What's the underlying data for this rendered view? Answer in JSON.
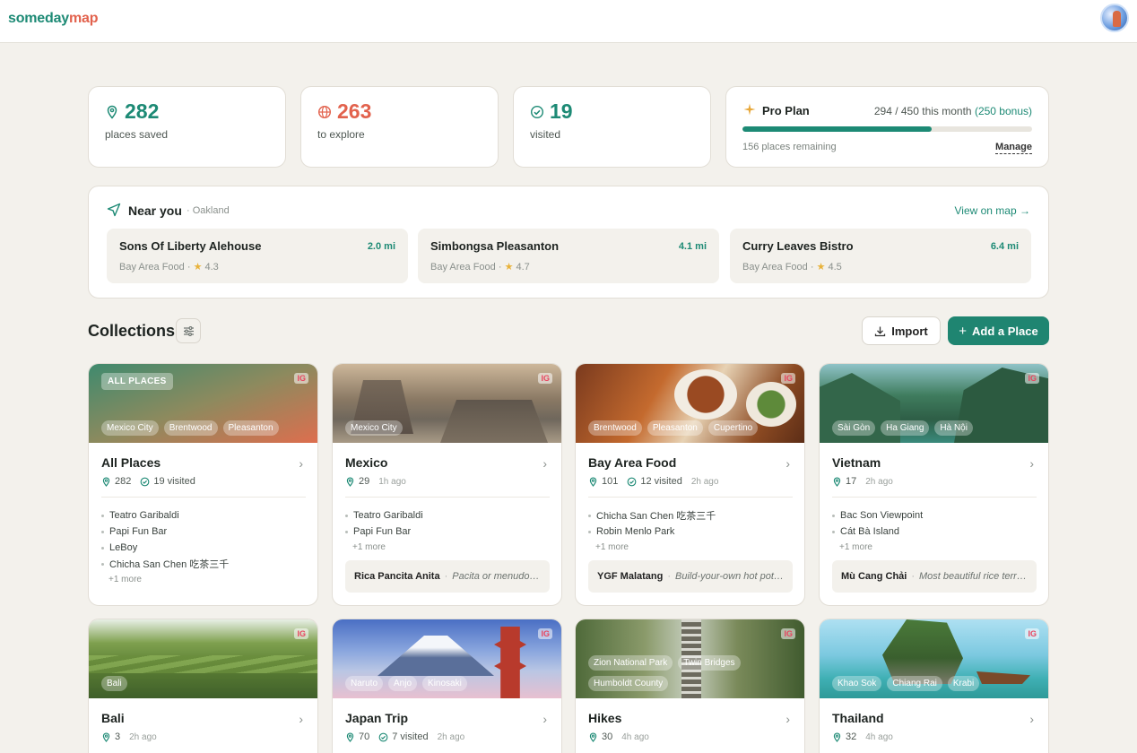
{
  "header": {
    "logo_part1": "someday",
    "logo_part2": "map",
    "colors": {
      "brand_green": "#1d8a75",
      "brand_coral": "#e2624d"
    }
  },
  "stats": [
    {
      "value": "282",
      "label": "places saved",
      "icon": "map-pin-icon",
      "color": "#1d8a75"
    },
    {
      "value": "263",
      "label": "to explore",
      "icon": "globe-icon",
      "color": "#e2624d"
    },
    {
      "value": "19",
      "label": "visited",
      "icon": "check-circle-icon",
      "color": "#1d8a75"
    }
  ],
  "plan": {
    "title": "Pro Plan",
    "usage": "294 / 450 this month",
    "bonus": "(250 bonus)",
    "used_fraction": 0.653,
    "remaining": "156 places remaining",
    "manage": "Manage"
  },
  "near": {
    "title": "Near you",
    "city": "· Oakland",
    "view_link": "View on map →",
    "items": [
      {
        "name": "Sons Of Liberty Alehouse",
        "distance": "2.0 mi",
        "collection": "Bay Area Food ·",
        "rating": "4.3"
      },
      {
        "name": "Simbongsa Pleasanton",
        "distance": "4.1 mi",
        "collection": "Bay Area Food ·",
        "rating": "4.7"
      },
      {
        "name": "Curry Leaves Bistro",
        "distance": "6.4 mi",
        "collection": "Bay Area Food ·",
        "rating": "4.5"
      }
    ]
  },
  "collections": {
    "title": "Collections",
    "import_label": "Import",
    "add_label": "Add a Place",
    "cards": [
      {
        "title": "All Places",
        "badge": "ALL PLACES",
        "ig": "IG",
        "tags": [
          "Mexico City",
          "Brentwood",
          "Pleasanton"
        ],
        "count": "282",
        "visited": "19 visited",
        "ago": "",
        "places": [
          "Teatro Garibaldi",
          "Papi Fun Bar",
          "LeBoy",
          "Chicha San Chen 吃茶三千"
        ],
        "more": "+1 more"
      },
      {
        "title": "Mexico",
        "ig": "IG",
        "tags": [
          "Mexico City"
        ],
        "count": "29",
        "visited": "",
        "ago": "1h ago",
        "places": [
          "Teatro Garibaldi",
          "Papi Fun Bar"
        ],
        "more": "+1 more",
        "note_who": "Rica Pancita Anita",
        "note_what": "Pacita or menudo - s..."
      },
      {
        "title": "Bay Area Food",
        "ig": "IG",
        "tags": [
          "Brentwood",
          "Pleasanton",
          "Cupertino"
        ],
        "count": "101",
        "visited": "12 visited",
        "ago": "2h ago",
        "places": [
          "Chicha San Chen 吃茶三千",
          "Robin Menlo Park"
        ],
        "more": "+1 more",
        "note_who": "YGF Malatang",
        "note_what": "Build-your-own hot pot ..."
      },
      {
        "title": "Vietnam",
        "ig": "IG",
        "tags": [
          "Sài Gòn",
          "Ha Giang",
          "Hà Nội"
        ],
        "count": "17",
        "visited": "",
        "ago": "2h ago",
        "places": [
          "Bac Son Viewpoint",
          "Cát Bà Island"
        ],
        "more": "+1 more",
        "note_who": "Mù Cang Chải",
        "note_what": "Most beautiful rice terra..."
      },
      {
        "title": "Bali",
        "ig": "IG",
        "tags": [
          "Bali"
        ],
        "count": "3",
        "visited": "",
        "ago": "2h ago"
      },
      {
        "title": "Japan Trip",
        "ig": "IG",
        "tags": [
          "Naruto",
          "Anjo",
          "Kinosaki"
        ],
        "count": "70",
        "visited": "7 visited",
        "ago": "2h ago"
      },
      {
        "title": "Hikes",
        "ig": "IG",
        "tags": [
          "Zion National Park",
          "Twin Bridges",
          "Humboldt County"
        ],
        "count": "30",
        "visited": "",
        "ago": "4h ago"
      },
      {
        "title": "Thailand",
        "ig": "IG",
        "tags": [
          "Khao Sok",
          "Chiang Rai",
          "Krabi"
        ],
        "count": "32",
        "visited": "",
        "ago": "4h ago"
      }
    ]
  }
}
